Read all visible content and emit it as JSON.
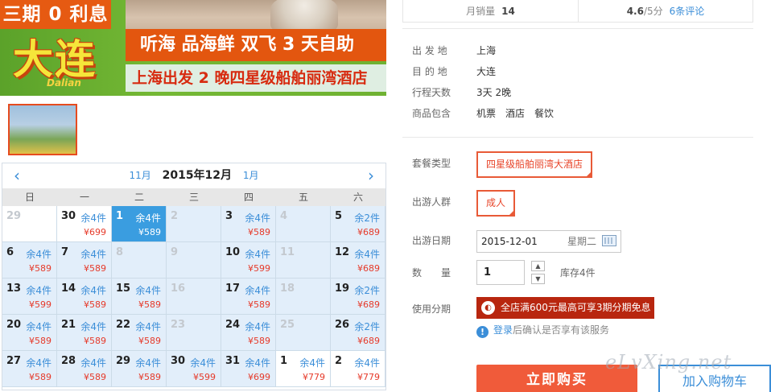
{
  "banner": {
    "tag": "三期 0 利息",
    "city": "大连",
    "pinyin": "Dalian",
    "line1": "听海 品海鲜 双飞 3 天自助",
    "line2": "上海出发 2 晚四星级船舶丽湾酒店"
  },
  "stats": {
    "sales_label": "月销量",
    "sales_value": "14",
    "rating": "4.6",
    "rating_suffix": "/5分",
    "reviews": "6条评论"
  },
  "info": {
    "depart_label": "出 发 地",
    "depart_value": "上海",
    "dest_label": "目 的 地",
    "dest_value": "大连",
    "days_label": "行程天数",
    "days_value": "3天 2晚",
    "includes_label": "商品包含",
    "includes": [
      "机票",
      "酒店",
      "餐饮"
    ]
  },
  "order": {
    "package_label": "套餐类型",
    "package_value": "四星级船舶丽湾大酒店",
    "crowd_label": "出游人群",
    "crowd_value": "成人",
    "date_label": "出游日期",
    "date_value": "2015-12-01",
    "weekday": "星期二",
    "qty_label": "数　　量",
    "qty_value": "1",
    "stock": "库存4件",
    "install_label": "使用分期",
    "promo": "全店满600元最高可享3期分期免息",
    "note_link": "登录",
    "note_rest": "后确认是否享有该服务",
    "buy": "立即购买",
    "cart": "加入购物车"
  },
  "calendar": {
    "prev_month": "11月",
    "current": "2015年12月",
    "next_month": "1月",
    "weekdays": [
      "日",
      "一",
      "二",
      "三",
      "四",
      "五",
      "六"
    ],
    "cells": [
      {
        "d": "29",
        "stock": "",
        "price": "",
        "state": "past"
      },
      {
        "d": "30",
        "stock": "余4件",
        "price": "¥699",
        "state": "past"
      },
      {
        "d": "1",
        "stock": "余4件",
        "price": "¥589",
        "state": "sel"
      },
      {
        "d": "2",
        "stock": "",
        "price": "",
        "state": "off"
      },
      {
        "d": "3",
        "stock": "余4件",
        "price": "¥589",
        "state": ""
      },
      {
        "d": "4",
        "stock": "",
        "price": "",
        "state": "off"
      },
      {
        "d": "5",
        "stock": "余2件",
        "price": "¥689",
        "state": ""
      },
      {
        "d": "6",
        "stock": "余4件",
        "price": "¥589",
        "state": ""
      },
      {
        "d": "7",
        "stock": "余4件",
        "price": "¥589",
        "state": ""
      },
      {
        "d": "8",
        "stock": "",
        "price": "",
        "state": "off"
      },
      {
        "d": "9",
        "stock": "",
        "price": "",
        "state": "off"
      },
      {
        "d": "10",
        "stock": "余4件",
        "price": "¥599",
        "state": ""
      },
      {
        "d": "11",
        "stock": "",
        "price": "",
        "state": "off"
      },
      {
        "d": "12",
        "stock": "余4件",
        "price": "¥689",
        "state": ""
      },
      {
        "d": "13",
        "stock": "余4件",
        "price": "¥599",
        "state": ""
      },
      {
        "d": "14",
        "stock": "余4件",
        "price": "¥589",
        "state": ""
      },
      {
        "d": "15",
        "stock": "余4件",
        "price": "¥589",
        "state": ""
      },
      {
        "d": "16",
        "stock": "",
        "price": "",
        "state": "off"
      },
      {
        "d": "17",
        "stock": "余4件",
        "price": "¥589",
        "state": ""
      },
      {
        "d": "18",
        "stock": "",
        "price": "",
        "state": "off"
      },
      {
        "d": "19",
        "stock": "余2件",
        "price": "¥689",
        "state": ""
      },
      {
        "d": "20",
        "stock": "余4件",
        "price": "¥589",
        "state": ""
      },
      {
        "d": "21",
        "stock": "余4件",
        "price": "¥589",
        "state": ""
      },
      {
        "d": "22",
        "stock": "余4件",
        "price": "¥589",
        "state": ""
      },
      {
        "d": "23",
        "stock": "",
        "price": "",
        "state": "off"
      },
      {
        "d": "24",
        "stock": "余4件",
        "price": "¥589",
        "state": ""
      },
      {
        "d": "25",
        "stock": "",
        "price": "",
        "state": "off"
      },
      {
        "d": "26",
        "stock": "余2件",
        "price": "¥689",
        "state": ""
      },
      {
        "d": "27",
        "stock": "余4件",
        "price": "¥589",
        "state": ""
      },
      {
        "d": "28",
        "stock": "余4件",
        "price": "¥589",
        "state": ""
      },
      {
        "d": "29",
        "stock": "余4件",
        "price": "¥589",
        "state": ""
      },
      {
        "d": "30",
        "stock": "余4件",
        "price": "¥599",
        "state": ""
      },
      {
        "d": "31",
        "stock": "余4件",
        "price": "¥699",
        "state": ""
      },
      {
        "d": "1",
        "stock": "余4件",
        "price": "¥779",
        "state": "past"
      },
      {
        "d": "2",
        "stock": "余4件",
        "price": "¥779",
        "state": "past"
      }
    ]
  },
  "watermark": "eLvXing.net"
}
